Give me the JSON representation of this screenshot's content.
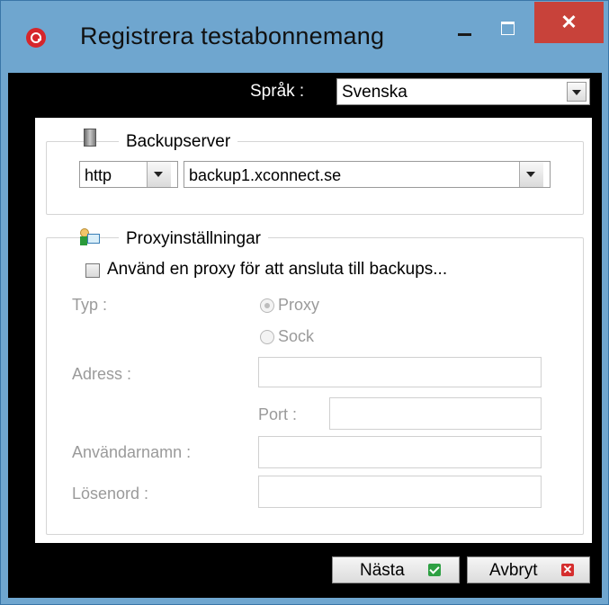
{
  "window": {
    "title": "Registrera testabonnemang",
    "controls": {
      "minimize": "–",
      "maximize": "□",
      "close": "✕"
    }
  },
  "language": {
    "label": "Språk :",
    "selected": "Svenska"
  },
  "backup_server": {
    "group_title": "Backupserver",
    "protocol": "http",
    "host": "backup1.xconnect.se"
  },
  "proxy": {
    "group_title": "Proxyinställningar",
    "use_proxy_label": "Använd en proxy för att ansluta till backups...",
    "use_proxy_checked": false,
    "type_label": "Typ :",
    "type_options": [
      {
        "label": "Proxy",
        "selected": true
      },
      {
        "label": "Sock",
        "selected": false
      }
    ],
    "address_label": "Adress :",
    "address_value": "",
    "port_label": "Port :",
    "port_value": "",
    "username_label": "Användarnamn :",
    "username_value": "",
    "password_label": "Lösenord :",
    "password_value": ""
  },
  "buttons": {
    "next": "Nästa",
    "cancel": "Avbryt"
  },
  "icons": {
    "app": "app-logo-icon",
    "server": "server-icon",
    "proxy": "proxy-user-icon",
    "next": "check-icon",
    "cancel": "x-icon"
  },
  "colors": {
    "title_bar": "#6fa6cf",
    "close_button": "#c8423a",
    "dialog_background": "#000000",
    "check_green": "#2ea043",
    "cancel_red": "#d52e2e"
  }
}
